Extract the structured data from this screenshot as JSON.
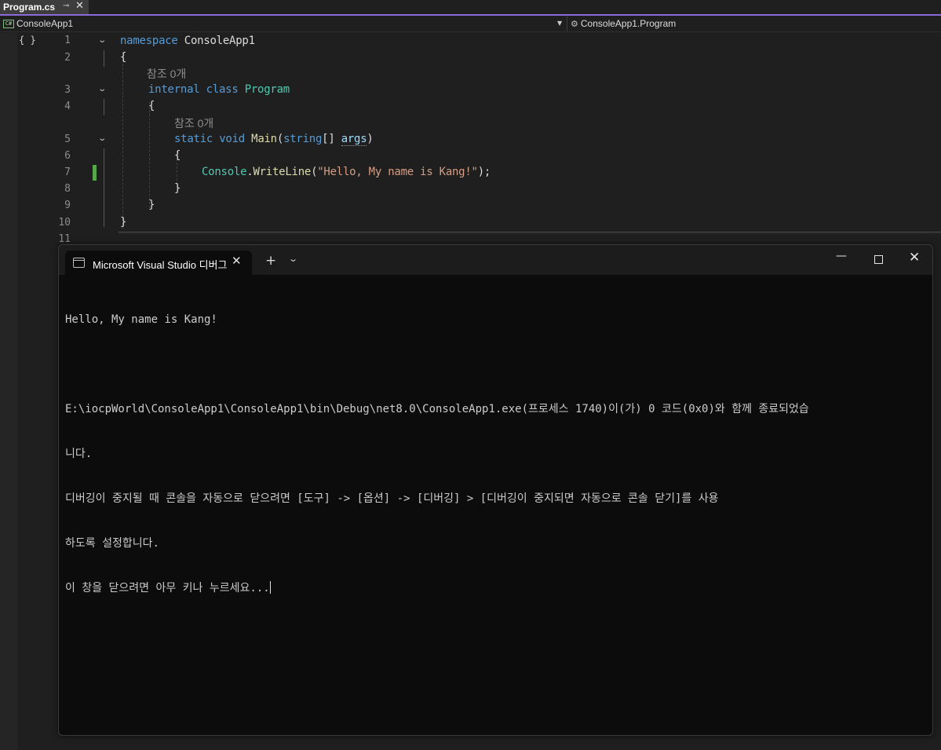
{
  "ide": {
    "tab": {
      "label": "Program.cs"
    },
    "navbar": {
      "project": "ConsoleApp1",
      "member": "ConsoleApp1.Program"
    },
    "line_numbers": [
      "1",
      "2",
      "3",
      "4",
      "5",
      "6",
      "7",
      "8",
      "9",
      "10",
      "11"
    ],
    "codelens": {
      "refs_class": "참조 0개",
      "refs_method": "참조 0개"
    },
    "code": {
      "l1_kw": "namespace",
      "l1_name": " ConsoleApp1",
      "l2": "{",
      "l3_kw": "internal class",
      "l3_name": " Program",
      "l4": "{",
      "l5_kw": "static void",
      "l5_fn": " Main",
      "l5_p1": "(",
      "l5_type": "string",
      "l5_p2": "[] ",
      "l5_arg": "args",
      "l5_p3": ")",
      "l6": "{",
      "l7_type": "Console",
      "l7_dot": ".",
      "l7_fn": "WriteLine",
      "l7_p1": "(",
      "l7_str": "\"Hello, My name is Kang!\"",
      "l7_p2": ");",
      "l8": "}",
      "l9": "}",
      "l10": "}"
    }
  },
  "console": {
    "tab_label": "Microsoft Visual Studio 디버그",
    "lines": [
      "Hello, My name is Kang!",
      "",
      "E:\\iocpWorld\\ConsoleApp1\\ConsoleApp1\\bin\\Debug\\net8.0\\ConsoleApp1.exe(프로세스 1740)이(가) 0 코드(0x0)와 함께 종료되었습",
      "니다.",
      "디버깅이 중지될 때 콘솔을 자동으로 닫으려면 [도구] -> [옵션] -> [디버깅] > [디버깅이 중지되면 자동으로 콘솔 닫기]를 사용",
      "하도록 설정합니다.",
      "이 창을 닫으려면 아무 키나 누르세요..."
    ]
  },
  "colors": {
    "accent": "#8a6ad6",
    "keyword": "#569cd6",
    "type": "#4ec9b0",
    "method": "#dcdcaa",
    "string": "#d69d85",
    "change_marker": "#57a64a"
  }
}
